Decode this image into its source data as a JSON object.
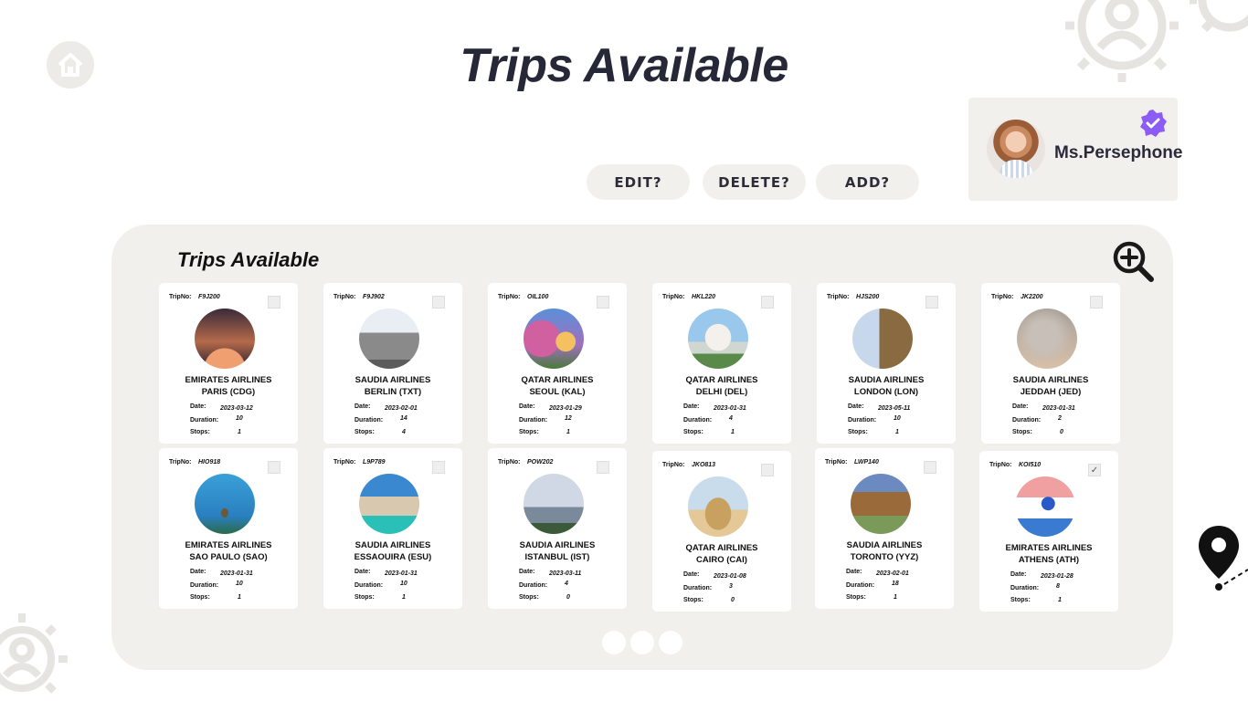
{
  "header": {
    "title": "Trips Available"
  },
  "profile": {
    "name": "Ms.Persephone"
  },
  "actions": {
    "edit_label": "EDIT?",
    "delete_label": "DELETE?",
    "add_label": "ADD?"
  },
  "panel": {
    "title": "Trips Available"
  },
  "labels": {
    "trip_no": "TripNo:",
    "date": "Date:",
    "duration": "Duration:",
    "stops": "Stops:"
  },
  "trips": [
    {
      "trip_no": "F9J200",
      "airline": "EMIRATES AIRLINES",
      "city": "PARIS (CDG)",
      "date": "2023-03-12",
      "duration": "10",
      "stops": "1",
      "selected": false
    },
    {
      "trip_no": "F9J902",
      "airline": "SAUDIA AIRLINES",
      "city": "BERLIN (TXT)",
      "date": "2023-02-01",
      "duration": "14",
      "stops": "4",
      "selected": false
    },
    {
      "trip_no": "OIL100",
      "airline": "QATAR AIRLINES",
      "city": "SEOUL (KAL)",
      "date": "2023-01-29",
      "duration": "12",
      "stops": "1",
      "selected": false
    },
    {
      "trip_no": "HKL220",
      "airline": "QATAR AIRLINES",
      "city": "DELHI (DEL)",
      "date": "2023-01-31",
      "duration": "4",
      "stops": "1",
      "selected": false
    },
    {
      "trip_no": "HJS200",
      "airline": "SAUDIA AIRLINES",
      "city": "LONDON (LON)",
      "date": "2023-05-11",
      "duration": "10",
      "stops": "1",
      "selected": false
    },
    {
      "trip_no": "JK2200",
      "airline": "SAUDIA AIRLINES",
      "city": "JEDDAH (JED)",
      "date": "2023-01-31",
      "duration": "2",
      "stops": "0",
      "selected": false
    },
    {
      "trip_no": "HIO918",
      "airline": "EMIRATES AIRLINES",
      "city": "SAO PAULO (SAO)",
      "date": "2023-01-31",
      "duration": "10",
      "stops": "1",
      "selected": false
    },
    {
      "trip_no": "L9P789",
      "airline": "SAUDIA AIRLINES",
      "city": "ESSAOUIRA (ESU)",
      "date": "2023-01-31",
      "duration": "10",
      "stops": "1",
      "selected": false
    },
    {
      "trip_no": "POW202",
      "airline": "SAUDIA AIRLINES",
      "city": "ISTANBUL (IST)",
      "date": "2023-03-11",
      "duration": "4",
      "stops": "0",
      "selected": false
    },
    {
      "trip_no": "JKO813",
      "airline": "QATAR AIRLINES",
      "city": "CAIRO (CAI)",
      "date": "2023-01-08",
      "duration": "3",
      "stops": "0",
      "selected": false
    },
    {
      "trip_no": "LWP140",
      "airline": "SAUDIA AIRLINES",
      "city": "TORONTO (YYZ)",
      "date": "2023-02-01",
      "duration": "18",
      "stops": "1",
      "selected": false
    },
    {
      "trip_no": "KOI510",
      "airline": "EMIRATES AIRLINES",
      "city": "ATHENS (ATH)",
      "date": "2023-01-28",
      "duration": "8",
      "stops": "1",
      "selected": true
    }
  ],
  "icons": {
    "home": "home-icon",
    "verified": "verified-badge-icon",
    "zoom": "zoom-in-icon",
    "map_pin": "map-pin-icon",
    "gear": "gear-user-icon"
  },
  "colors": {
    "panel_bg": "#f2f0ec",
    "title": "#262838",
    "verified": "#8b5cf6"
  }
}
